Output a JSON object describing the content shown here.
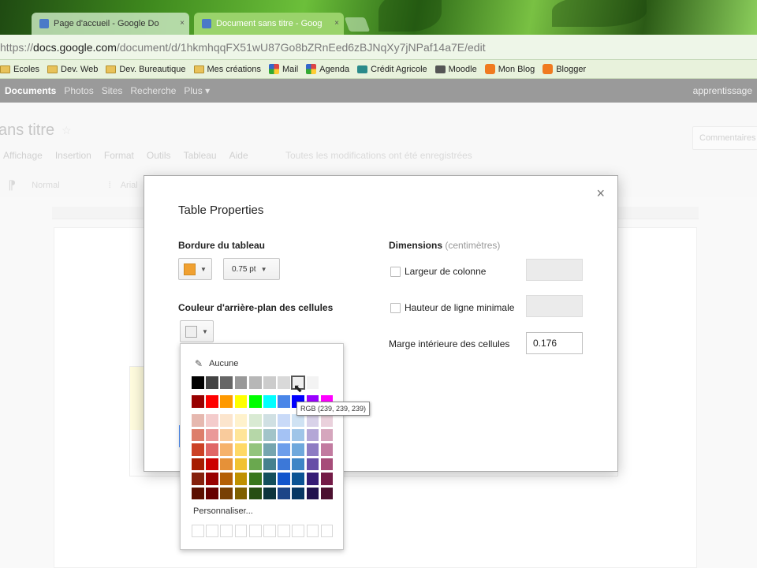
{
  "browser": {
    "tabs": [
      {
        "label": "Page d'accueil - Google Do",
        "close": "×"
      },
      {
        "label": "Document sans titre - Goog",
        "close": "×"
      }
    ],
    "url_prefix": "https://",
    "url_host": "docs.google.com",
    "url_path": "/document/d/1hkmhqqFX51wU87Go8bZRnEed6zBJNqXy7jNPaf14a7E/edit",
    "bookmarks": [
      {
        "label": "Ecoles",
        "icon": "folder-icon"
      },
      {
        "label": "Dev. Web",
        "icon": "folder-icon"
      },
      {
        "label": "Dev. Bureautique",
        "icon": "folder-icon"
      },
      {
        "label": "Mes créations",
        "icon": "folder-icon"
      },
      {
        "label": "Mail",
        "icon": "google-icon"
      },
      {
        "label": "Agenda",
        "icon": "google-icon"
      },
      {
        "label": "Crédit Agricole",
        "icon": "bank-icon"
      },
      {
        "label": "Moodle",
        "icon": "moodle-icon"
      },
      {
        "label": "Mon Blog",
        "icon": "blogger-icon"
      },
      {
        "label": "Blogger",
        "icon": "blogger-icon"
      }
    ]
  },
  "gbar": {
    "items": [
      "Documents",
      "Photos",
      "Sites",
      "Recherche",
      "Plus ▾"
    ],
    "account": "apprentissage"
  },
  "doc": {
    "title": "ans titre",
    "comment_button": "Commentaires",
    "menu": [
      "Affichage",
      "Insertion",
      "Format",
      "Outils",
      "Tableau",
      "Aide"
    ],
    "saved_status": "Toutes les modifications ont été enregistrées",
    "toolbar": {
      "style": "Normal",
      "font": "Arial"
    }
  },
  "dialog": {
    "title": "Table Properties",
    "close": "×",
    "border_label": "Bordure du tableau",
    "border_color": "#f0a030",
    "border_width": "0.75 pt",
    "cell_bg_label": "Couleur d'arrière-plan des cellules",
    "cell_bg_color": "#efefef",
    "dimensions_label": "Dimensions",
    "dimensions_unit": "(centimètres)",
    "col_width_label": "Largeur de colonne",
    "row_height_label": "Hauteur de ligne minimale",
    "padding_label": "Marge intérieure des cellules",
    "padding_value": "0.176"
  },
  "palette": {
    "none_label": "Aucune",
    "custom_label": "Personnaliser...",
    "tooltip": "RGB (239, 239, 239)",
    "greys": [
      "#000000",
      "#434343",
      "#666666",
      "#999999",
      "#b7b7b7",
      "#cccccc",
      "#d9d9d9",
      "#efefef",
      "#f3f3f3",
      "#ffffff"
    ],
    "brights": [
      "#980000",
      "#ff0000",
      "#ff9900",
      "#ffff00",
      "#00ff00",
      "#00ffff",
      "#4a86e8",
      "#0000ff",
      "#9900ff",
      "#ff00ff"
    ],
    "shades": [
      [
        "#e6b8af",
        "#f4cccc",
        "#fce5cd",
        "#fff2cc",
        "#d9ead3",
        "#d0e0e3",
        "#c9daf8",
        "#cfe2f3",
        "#d9d2e9",
        "#ead1dc"
      ],
      [
        "#dd7e6b",
        "#ea9999",
        "#f9cb9c",
        "#ffe599",
        "#b6d7a8",
        "#a2c4c9",
        "#a4c2f4",
        "#9fc5e8",
        "#b4a7d6",
        "#d5a6bd"
      ],
      [
        "#cc4125",
        "#e06666",
        "#f6b26b",
        "#ffd966",
        "#93c47d",
        "#76a5af",
        "#6d9eeb",
        "#6fa8dc",
        "#8e7cc3",
        "#c27ba0"
      ],
      [
        "#a61c00",
        "#cc0000",
        "#e69138",
        "#f1c232",
        "#6aa84f",
        "#45818e",
        "#3c78d8",
        "#3d85c6",
        "#674ea7",
        "#a64d79"
      ],
      [
        "#85200c",
        "#990000",
        "#b45f06",
        "#bf9000",
        "#38761d",
        "#134f5c",
        "#1155cc",
        "#0b5394",
        "#351c75",
        "#741b47"
      ],
      [
        "#5b0f00",
        "#660000",
        "#783f04",
        "#7f6000",
        "#274e13",
        "#0c343d",
        "#1c4587",
        "#073763",
        "#20124d",
        "#4c1130"
      ]
    ]
  }
}
